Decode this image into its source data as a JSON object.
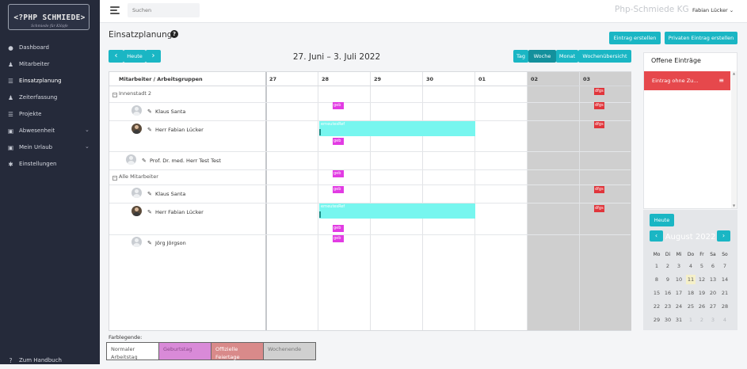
{
  "brand": {
    "logo_text": "<?PHP SCHMIEDE>",
    "logo_sub": "Schmiede für Klöpfe"
  },
  "sidebar": {
    "items": [
      {
        "label": "Dashboard",
        "icon": "dashboard-icon",
        "glyph": "●"
      },
      {
        "label": "Mitarbeiter",
        "icon": "user-icon",
        "glyph": "♟"
      },
      {
        "label": "Einsatzplanung",
        "icon": "list-icon",
        "glyph": "☰",
        "active": true
      },
      {
        "label": "Zeiterfassung",
        "icon": "users-icon",
        "glyph": "♟"
      },
      {
        "label": "Projekte",
        "icon": "list-icon",
        "glyph": "☰"
      },
      {
        "label": "Abwesenheit",
        "icon": "suitcase-icon",
        "glyph": "▣",
        "has_children": true
      },
      {
        "label": "Mein Urlaub",
        "icon": "suitcase-icon",
        "glyph": "▣",
        "has_children": true
      },
      {
        "label": "Einstellungen",
        "icon": "gear-icon",
        "glyph": "✱"
      }
    ],
    "footer": {
      "label": "Zum Handbuch",
      "glyph": "?"
    }
  },
  "topbar": {
    "search_placeholder": "Suchen",
    "company": "Php-Schmiede KG",
    "user": "Fabian Lücker"
  },
  "page": {
    "title": "Einsatzplanung",
    "help": "?"
  },
  "actions": {
    "create": "Eintrag erstellen",
    "create_private": "Privaten Eintrag erstellen"
  },
  "toolbar": {
    "prev": "‹",
    "today": "Heute",
    "next": "›",
    "range": "27. Juni – 3. Juli 2022",
    "views": [
      {
        "label": "Tag",
        "active": false
      },
      {
        "label": "Woche",
        "active": true
      },
      {
        "label": "Monat",
        "active": false
      },
      {
        "label": "Wochenübersicht",
        "active": false
      }
    ]
  },
  "calendar": {
    "resource_header": "Mitarbeiter / Arbeitsgruppen",
    "days": [
      "27",
      "28",
      "29",
      "30",
      "01",
      "02",
      "03"
    ],
    "groups": [
      {
        "label": "Innenstadt 2"
      },
      {
        "label": "Alle Mitarbeiter"
      }
    ],
    "employees": [
      "Klaus Santa",
      "Herr Fabian Lücker",
      "Prof. Dr. med. Herr Test Test",
      "Klaus Santa",
      "Herr Fabian Lücker",
      "Jörg Jörgson"
    ],
    "badges": {
      "birthday": "geb",
      "holiday": "dfgs"
    },
    "event_label": "erneutesRef"
  },
  "open_entries": {
    "title": "Offene Einträge",
    "entry": "Eintrag ohne Zu...",
    "menu_glyph": "≡"
  },
  "mini_calendar": {
    "today_label": "Heute",
    "title": "August 2022",
    "prev": "‹",
    "next": "›",
    "dow": [
      "Mo",
      "Di",
      "Mi",
      "Do",
      "Fr",
      "Sa",
      "So"
    ],
    "weeks": [
      [
        "1",
        "2",
        "3",
        "4",
        "5",
        "6",
        "7"
      ],
      [
        "8",
        "9",
        "10",
        "11",
        "12",
        "13",
        "14"
      ],
      [
        "15",
        "16",
        "17",
        "18",
        "19",
        "20",
        "21"
      ],
      [
        "22",
        "23",
        "24",
        "25",
        "26",
        "27",
        "28"
      ],
      [
        "29",
        "30",
        "31",
        "1",
        "2",
        "3",
        "4"
      ]
    ]
  },
  "legend": {
    "title": "Farblegende:",
    "items": [
      {
        "label": "Normaler Arbeitstag",
        "color": "#ffffff",
        "text": "#555555"
      },
      {
        "label": "Geburtstag",
        "color": "#d98ad8",
        "text": "#8a4a8a"
      },
      {
        "label": "Offizielle Feiertage",
        "color": "#d98a8a",
        "text": "#ffffff"
      },
      {
        "label": "Wochenende",
        "color": "#d0d0d0",
        "text": "#777777"
      }
    ]
  },
  "colors": {
    "accent": "#1ab6c4",
    "sidebar": "#252a3a",
    "event": "#77f6ef",
    "birthday": "#e23be3",
    "holiday": "#e0353b",
    "open_entry": "#e6484c"
  }
}
